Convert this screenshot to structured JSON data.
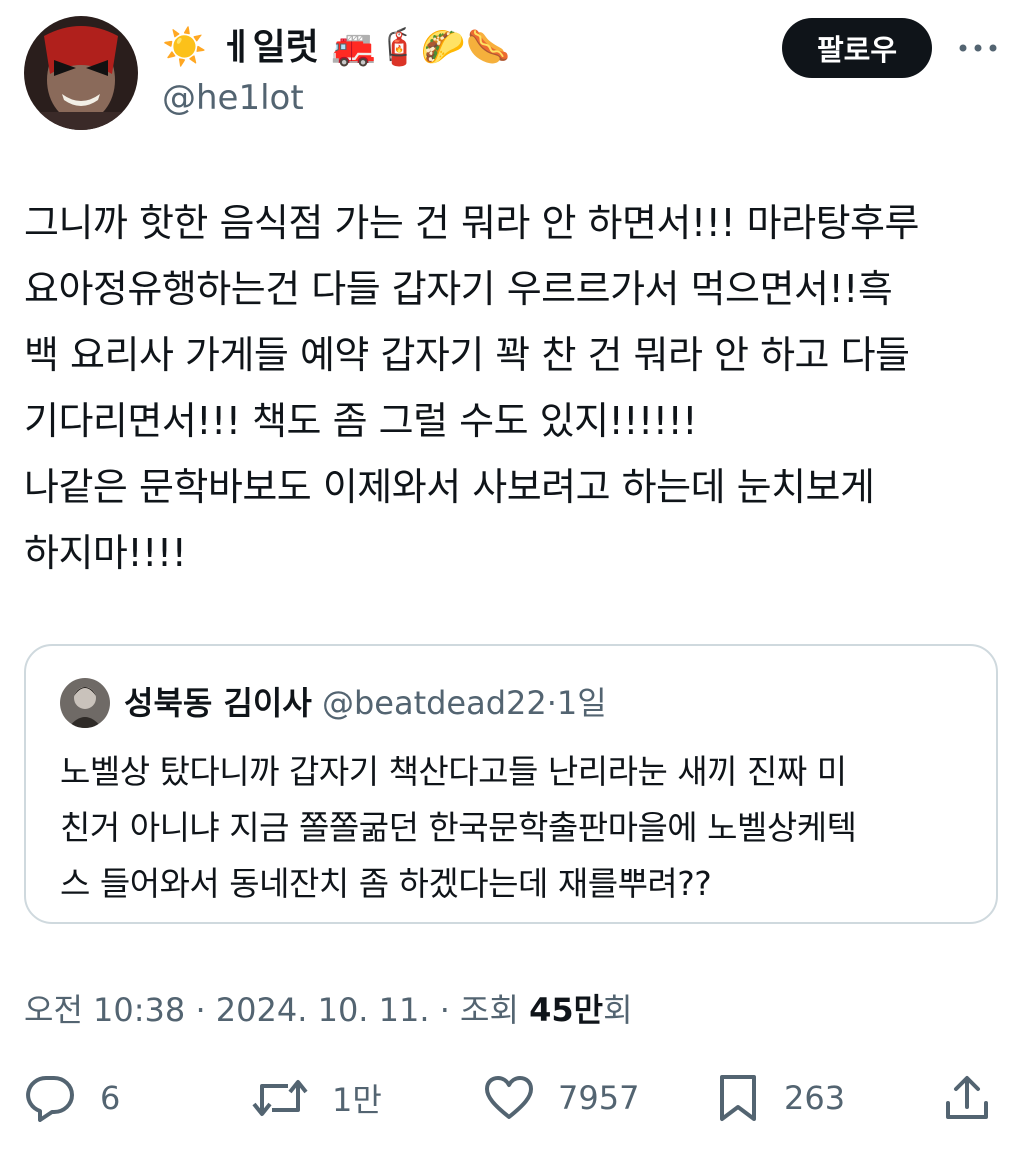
{
  "author": {
    "display_name": "☀️ ㅔ일럿 🚒🧯🌮🌭",
    "handle": "@he1lot",
    "avatar": "avatar-icon"
  },
  "follow_label": "팔로우",
  "tweet": {
    "text": "그니까 핫한 음식점 가는 건 뭐라 안 하면서!!! 마라탕후루\n요아정유행하는건 다들 갑자기 우르르가서 먹으면서!!흑\n백 요리사 가게들 예약 갑자기 꽉 찬 건 뭐라 안 하고 다들\n기다리면서!!! 책도 좀 그럴 수도 있지!!!!!!\n나같은 문학바보도 이제와서 사보려고 하는데 눈치보게\n하지마!!!!"
  },
  "quote": {
    "name": "성북동 김이사",
    "handle": "@beatdead22",
    "separator": "·",
    "time": "1일",
    "text": "노벨상 탔다니까 갑자기 책산다고들 난리라눈 새끼 진짜 미\n친거 아니냐 지금 쫄쫄굶던 한국문학출판마을에 노벨상케텍\n스 들어와서 동네잔치 좀 하겠다는데 재를뿌려??"
  },
  "meta": {
    "time": "오전 10:38",
    "date": "2024. 10. 11.",
    "separator": "·",
    "views_label": "조회",
    "views_count": "45만",
    "views_suffix": "회"
  },
  "actions": {
    "replies": "6",
    "retweets": "1만",
    "likes": "7957",
    "bookmarks": "263"
  },
  "colors": {
    "text": "#0f1419",
    "secondary": "#536471",
    "border": "#cfd9de",
    "button_bg": "#0f1419"
  }
}
